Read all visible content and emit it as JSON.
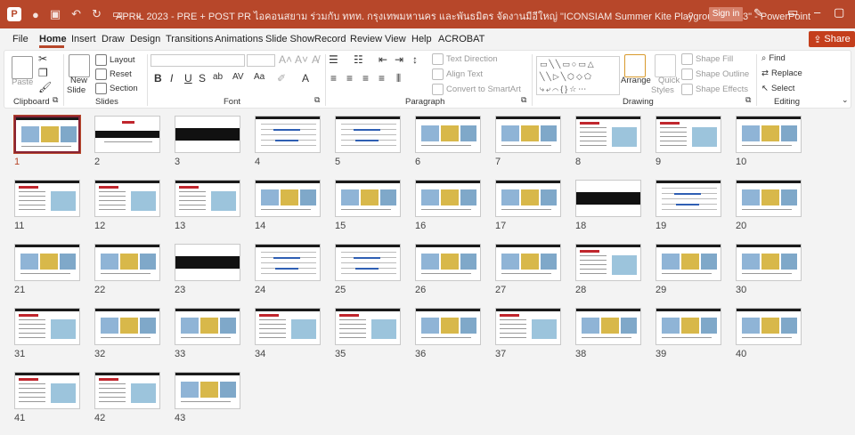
{
  "window": {
    "title": "APRIL 2023 - PRE + POST PR  ไอคอนสยาม ร่วมกับ ททท. กรุงเทพมหานคร  และพันธมิตร  จัดงานมีอีใหญ่ \"ICONSIAM Summer Kite Playground 2023\"  -  PowerPoint",
    "app_logo": "P",
    "sign_in": "Sign in"
  },
  "tabs": [
    "File",
    "Home",
    "Insert",
    "Draw",
    "Design",
    "Transitions",
    "Animations",
    "Slide Show",
    "Record",
    "Review",
    "View",
    "Help",
    "ACROBAT"
  ],
  "active_tab": "Home",
  "share_label": "Share",
  "ribbon": {
    "clipboard": {
      "label": "Clipboard",
      "paste": "Paste"
    },
    "slides": {
      "label": "Slides",
      "new_slide_1": "New",
      "new_slide_2": "Slide",
      "layout": "Layout",
      "reset": "Reset",
      "section": "Section"
    },
    "font": {
      "label": "Font",
      "bold": "B",
      "italic": "I",
      "underline": "U",
      "strike": "S",
      "shadow": "ab",
      "spacing": "AV",
      "case": "Aa"
    },
    "paragraph": {
      "label": "Paragraph",
      "text_direction": "Text Direction",
      "align_text": "Align Text",
      "convert_smartart": "Convert to SmartArt"
    },
    "drawing": {
      "label": "Drawing",
      "arrange": "Arrange",
      "quick_styles_1": "Quick",
      "quick_styles_2": "Styles",
      "shape_fill": "Shape Fill",
      "shape_outline": "Shape Outline",
      "shape_effects": "Shape Effects"
    },
    "editing": {
      "label": "Editing",
      "find": "Find",
      "replace": "Replace",
      "select": "Select"
    }
  },
  "slides": [
    "1",
    "2",
    "3",
    "4",
    "5",
    "6",
    "7",
    "8",
    "9",
    "10",
    "11",
    "12",
    "13",
    "14",
    "15",
    "16",
    "17",
    "18",
    "19",
    "20",
    "21",
    "22",
    "23",
    "24",
    "25",
    "26",
    "27",
    "28",
    "29",
    "30",
    "31",
    "32",
    "33",
    "34",
    "35",
    "36",
    "37",
    "38",
    "39",
    "40",
    "41",
    "42",
    "43"
  ],
  "selected_slide": "1",
  "colors": {
    "accent": "#b7472a",
    "share": "#c43e1c",
    "selected_border": "#8a2434"
  }
}
